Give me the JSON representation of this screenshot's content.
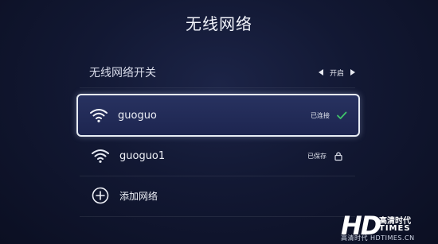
{
  "page": {
    "title": "无线网络"
  },
  "wifi_toggle": {
    "label": "无线网络开关",
    "value": "开启"
  },
  "networks": [
    {
      "name": "guoguo",
      "status": "已连接",
      "status_icon": "check-icon",
      "focused": true
    },
    {
      "name": "guoguo1",
      "status": "已保存",
      "status_icon": "lock-icon",
      "focused": false
    }
  ],
  "add_network": {
    "label": "添加网络",
    "icon": "plus-circle-icon"
  },
  "watermark": {
    "logo": "HD",
    "cn": "高清时代",
    "en": "TIMES",
    "url": "高清时代 HDTIMES.CN"
  },
  "colors": {
    "accent_check": "#3fc46a",
    "focus_border": "#e7ecf4"
  }
}
